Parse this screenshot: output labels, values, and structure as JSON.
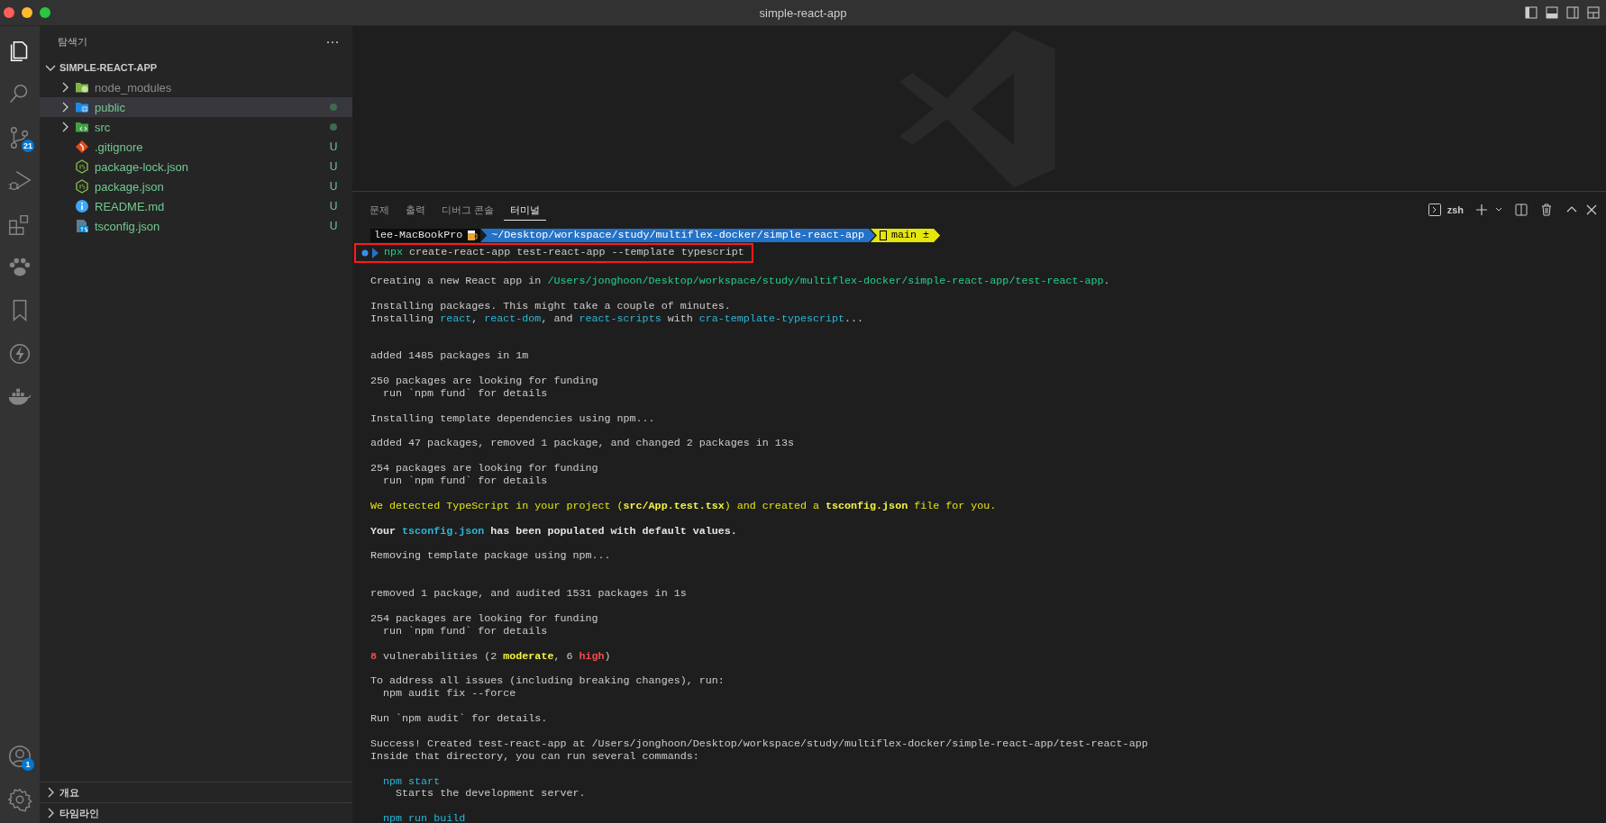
{
  "window": {
    "title": "simple-react-app"
  },
  "activity_bar": {
    "top": [
      {
        "kind": "files",
        "selected": true
      },
      {
        "kind": "search",
        "selected": false
      },
      {
        "kind": "source-control",
        "selected": false,
        "badge": "21"
      },
      {
        "kind": "run-debug",
        "selected": false
      },
      {
        "kind": "extensions",
        "selected": false
      },
      {
        "kind": "paw",
        "selected": false
      },
      {
        "kind": "bookmark",
        "selected": false
      },
      {
        "kind": "bolt",
        "selected": false
      },
      {
        "kind": "whale",
        "selected": false
      }
    ],
    "bottom": [
      {
        "kind": "account",
        "selected": false,
        "badge": "1"
      },
      {
        "kind": "settings",
        "selected": false
      }
    ]
  },
  "sidebar": {
    "title": "탐색기",
    "section": {
      "title": "SIMPLE-REACT-APP",
      "expanded": true,
      "items": [
        {
          "name": "node_modules",
          "kind": "modules-folder",
          "expanded": false,
          "selected": false,
          "ignored": true
        },
        {
          "name": "public",
          "kind": "public-folder",
          "expanded": false,
          "selected": true,
          "ignored": false
        },
        {
          "name": "src",
          "kind": "source-folder",
          "expanded": false,
          "selected": false,
          "ignored": false
        },
        {
          "name": ".gitignore",
          "kind": "git-file",
          "selected": false,
          "ignored": false,
          "badge": "U"
        },
        {
          "name": "package-lock.json",
          "kind": "node-file",
          "selected": false,
          "ignored": false,
          "badge": "U"
        },
        {
          "name": "package.json",
          "kind": "node-file",
          "selected": false,
          "ignored": false,
          "badge": "U"
        },
        {
          "name": "README.md",
          "kind": "info-file",
          "selected": false,
          "ignored": false,
          "badge": "U"
        },
        {
          "name": "tsconfig.json",
          "kind": "ts-file",
          "selected": false,
          "ignored": false,
          "badge": "U"
        }
      ]
    },
    "collapsed_sections": [
      {
        "title": "개요",
        "expanded": false
      },
      {
        "title": "타임라인",
        "expanded": false
      }
    ]
  },
  "panel": {
    "tabs": [
      {
        "label": "문제",
        "selected": false
      },
      {
        "label": "출력",
        "selected": false
      },
      {
        "label": "디버그 콘솔",
        "selected": false
      },
      {
        "label": "터미널",
        "selected": true
      }
    ],
    "shell": "zsh",
    "prompt": {
      "host": "lee-MacBookPro",
      "path": "~/Desktop/workspace/study/multiflex-docker/simple-react-app",
      "branch": "main ±"
    },
    "command": {
      "highlighted": true,
      "segments": [
        {
          "text": "npx",
          "kind": "cmd"
        },
        {
          "text": " create-react-app test-react-app --template typescript",
          "kind": "plain"
        }
      ]
    },
    "lines": [
      {
        "kind": "blank"
      },
      {
        "kind": "text",
        "segments": [
          {
            "text": "Creating a new React app in ",
            "kind": "plain"
          },
          {
            "text": "/Users/jonghoon/Desktop/workspace/study/multiflex-docker/simple-react-app/test-react-app",
            "kind": "path"
          },
          {
            "text": ".",
            "kind": "plain"
          }
        ]
      },
      {
        "kind": "blank"
      },
      {
        "kind": "text",
        "segments": [
          {
            "text": "Installing packages. This might take a couple of minutes.",
            "kind": "plain"
          }
        ]
      },
      {
        "kind": "text",
        "segments": [
          {
            "text": "Installing ",
            "kind": "plain"
          },
          {
            "text": "react",
            "kind": "pkg"
          },
          {
            "text": ", ",
            "kind": "plain"
          },
          {
            "text": "react-dom",
            "kind": "pkg"
          },
          {
            "text": ", and ",
            "kind": "plain"
          },
          {
            "text": "react-scripts",
            "kind": "pkg"
          },
          {
            "text": " with ",
            "kind": "plain"
          },
          {
            "text": "cra-template-typescript",
            "kind": "pkg"
          },
          {
            "text": "...",
            "kind": "plain"
          }
        ]
      },
      {
        "kind": "blank"
      },
      {
        "kind": "blank"
      },
      {
        "kind": "text",
        "segments": [
          {
            "text": "added 1485 packages in 1m",
            "kind": "plain"
          }
        ]
      },
      {
        "kind": "blank"
      },
      {
        "kind": "text",
        "segments": [
          {
            "text": "250 packages are looking for funding",
            "kind": "plain"
          }
        ]
      },
      {
        "kind": "text",
        "segments": [
          {
            "text": "  run `npm fund` for details",
            "kind": "plain"
          }
        ]
      },
      {
        "kind": "blank"
      },
      {
        "kind": "text",
        "segments": [
          {
            "text": "Installing template dependencies using npm...",
            "kind": "plain"
          }
        ]
      },
      {
        "kind": "blank"
      },
      {
        "kind": "text",
        "segments": [
          {
            "text": "added 47 packages, removed 1 package, and changed 2 packages in 13s",
            "kind": "plain"
          }
        ]
      },
      {
        "kind": "blank"
      },
      {
        "kind": "text",
        "segments": [
          {
            "text": "254 packages are looking for funding",
            "kind": "plain"
          }
        ]
      },
      {
        "kind": "text",
        "segments": [
          {
            "text": "  run `npm fund` for details",
            "kind": "plain"
          }
        ]
      },
      {
        "kind": "blank"
      },
      {
        "kind": "text",
        "segments": [
          {
            "text": "We detected TypeScript in your project (",
            "kind": "warn"
          },
          {
            "text": "src/App.test.tsx",
            "kind": "warn-bold"
          },
          {
            "text": ") and created a ",
            "kind": "warn"
          },
          {
            "text": "tsconfig.json",
            "kind": "warn-bold"
          },
          {
            "text": " file for you.",
            "kind": "warn"
          }
        ]
      },
      {
        "kind": "blank"
      },
      {
        "kind": "text",
        "segments": [
          {
            "text": "Your ",
            "kind": "bold"
          },
          {
            "text": "tsconfig.json",
            "kind": "pkg-bold"
          },
          {
            "text": " has been populated with default values.",
            "kind": "bold"
          }
        ]
      },
      {
        "kind": "blank"
      },
      {
        "kind": "text",
        "segments": [
          {
            "text": "Removing template package using npm...",
            "kind": "plain"
          }
        ]
      },
      {
        "kind": "blank"
      },
      {
        "kind": "blank"
      },
      {
        "kind": "text",
        "segments": [
          {
            "text": "removed 1 package, and audited 1531 packages in 1s",
            "kind": "plain"
          }
        ]
      },
      {
        "kind": "blank"
      },
      {
        "kind": "text",
        "segments": [
          {
            "text": "254 packages are looking for funding",
            "kind": "plain"
          }
        ]
      },
      {
        "kind": "text",
        "segments": [
          {
            "text": "  run `npm fund` for details",
            "kind": "plain"
          }
        ]
      },
      {
        "kind": "blank"
      },
      {
        "kind": "text",
        "segments": [
          {
            "text": "8",
            "kind": "error-bold"
          },
          {
            "text": " vulnerabilities (2 ",
            "kind": "plain"
          },
          {
            "text": "moderate",
            "kind": "warn-bold"
          },
          {
            "text": ", 6 ",
            "kind": "plain"
          },
          {
            "text": "high",
            "kind": "error-bold"
          },
          {
            "text": ")",
            "kind": "plain"
          }
        ]
      },
      {
        "kind": "blank"
      },
      {
        "kind": "text",
        "segments": [
          {
            "text": "To address all issues (including breaking changes), run:",
            "kind": "plain"
          }
        ]
      },
      {
        "kind": "text",
        "segments": [
          {
            "text": "  npm audit fix --force",
            "kind": "plain"
          }
        ]
      },
      {
        "kind": "blank"
      },
      {
        "kind": "text",
        "segments": [
          {
            "text": "Run `npm audit` for details.",
            "kind": "plain"
          }
        ]
      },
      {
        "kind": "blank"
      },
      {
        "kind": "text",
        "segments": [
          {
            "text": "Success! Created test-react-app at /Users/jonghoon/Desktop/workspace/study/multiflex-docker/simple-react-app/test-react-app",
            "kind": "plain"
          }
        ]
      },
      {
        "kind": "text",
        "segments": [
          {
            "text": "Inside that directory, you can run several commands:",
            "kind": "plain"
          }
        ]
      },
      {
        "kind": "blank"
      },
      {
        "kind": "text",
        "segments": [
          {
            "text": "  npm start",
            "kind": "pkg"
          }
        ]
      },
      {
        "kind": "text",
        "segments": [
          {
            "text": "    Starts the development server.",
            "kind": "plain"
          }
        ]
      },
      {
        "kind": "blank"
      },
      {
        "kind": "text",
        "segments": [
          {
            "text": "  npm run build",
            "kind": "pkg"
          }
        ]
      }
    ]
  }
}
